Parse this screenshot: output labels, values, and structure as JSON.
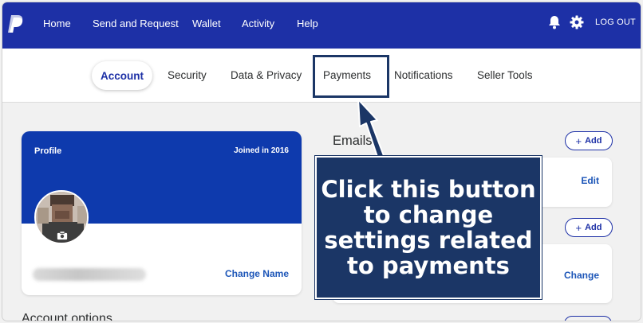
{
  "nav": {
    "links": [
      "Home",
      "Send and Request",
      "Wallet",
      "Activity",
      "Help"
    ],
    "logout_label": "LOG OUT"
  },
  "tabs": {
    "active": "Account",
    "items": [
      "Security",
      "Data & Privacy",
      "Payments",
      "Notifications",
      "Seller Tools"
    ]
  },
  "profile": {
    "label": "Profile",
    "joined": "Joined in 2016",
    "change_name_label": "Change Name"
  },
  "account_options_title": "Account options",
  "emails": {
    "title": "Emails",
    "add_label": "Add",
    "edit_label": "Edit"
  },
  "phone": {
    "add_label": "Add",
    "change_label": "Change"
  },
  "callout": {
    "text": "Click this button to change settings related to payments"
  },
  "colors": {
    "nav_bg": "#1d30a6",
    "profile_bg": "#0e3aad",
    "callout_bg": "#1b3666",
    "link": "#1d56b8"
  },
  "icons": [
    "paypal-logo-icon",
    "bell-icon",
    "gear-icon",
    "camera-icon",
    "plus-icon",
    "arrow-pointer-icon"
  ]
}
